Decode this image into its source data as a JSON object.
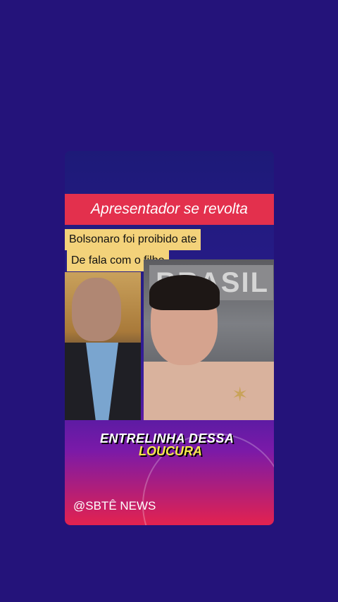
{
  "headline": "Apresentador se revolta",
  "tags": [
    "Bolsonaro foi proibido ate",
    "De fala com o filho"
  ],
  "sign_text": "BRASIL",
  "caption": {
    "line1": "ENTRELINHA DESSA",
    "line2": "LOUCURA"
  },
  "footer": "@SBTÊ NEWS",
  "colors": {
    "background": "#24137a",
    "headline_bg": "#e3304d",
    "tag_bg": "#f3d27a"
  }
}
